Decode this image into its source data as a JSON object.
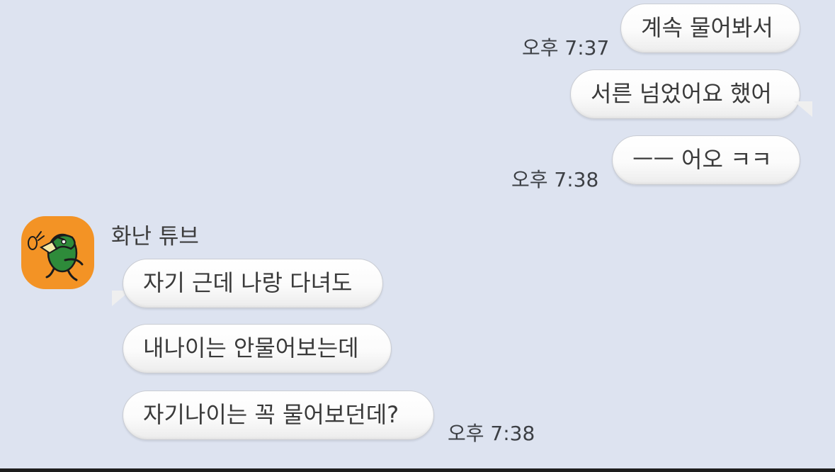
{
  "outgoing": [
    {
      "text": "계속 물어봐서",
      "time": "오후 7:37"
    },
    {
      "text": "서른 넘었어요 했어",
      "time": ""
    },
    {
      "text": "ㅡㅡ 어오 ㅋㅋ",
      "time": "오후 7:38"
    }
  ],
  "incoming": {
    "sender": "화난 튜브",
    "avatar_icon": "angry-tube-duck-icon",
    "messages": [
      {
        "text": "자기 근데 나랑 다녀도",
        "time": ""
      },
      {
        "text": "내나이는 안물어보는데",
        "time": ""
      },
      {
        "text": "자기나이는 꼭 물어보던데?",
        "time": "오후 7:38"
      }
    ]
  },
  "colors": {
    "background": "#dde3f0",
    "bubble": "#ffffff",
    "avatar_bg": "#f39325",
    "character_green": "#2e8b3a"
  }
}
